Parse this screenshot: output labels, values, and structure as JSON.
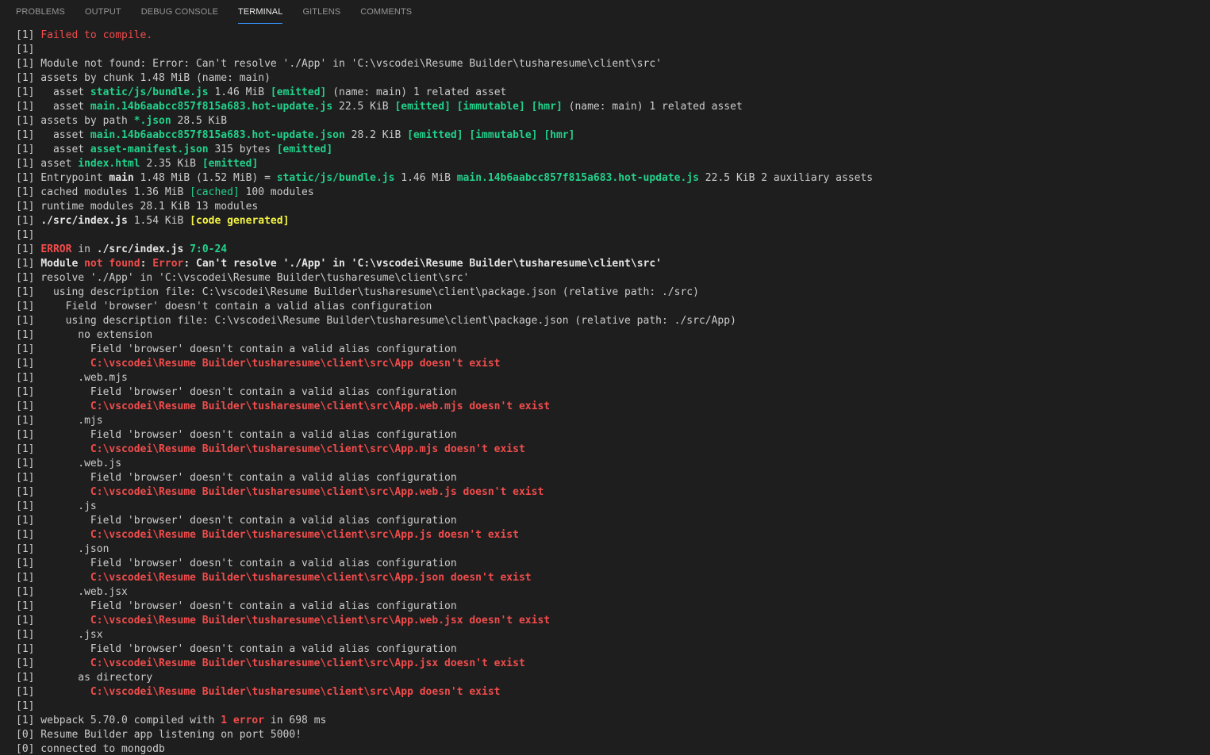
{
  "tabs": [
    "PROBLEMS",
    "OUTPUT",
    "DEBUG CONSOLE",
    "TERMINAL",
    "GITLENS",
    "COMMENTS"
  ],
  "active_tab": "TERMINAL",
  "colors": {
    "background": "#1e1e1e",
    "default": "#cccccc",
    "red": "#f14c4c",
    "green": "#23d18b",
    "yellow": "#f5f543",
    "active_tab_underline": "#3794ff"
  },
  "terminal_lines": [
    [
      {
        "t": "[1] "
      },
      {
        "t": "Failed to compile.",
        "c": "red"
      }
    ],
    [
      {
        "t": "[1]"
      }
    ],
    [
      {
        "t": "[1] Module not found: Error: Can't resolve './App' in 'C:\\vscodei\\Resume Builder\\tusharesume\\client\\src'"
      }
    ],
    [
      {
        "t": "[1] assets by chunk 1.48 MiB (name: main)"
      }
    ],
    [
      {
        "t": "[1]   asset "
      },
      {
        "t": "static/js/bundle.js",
        "c": "green b"
      },
      {
        "t": " 1.46 MiB "
      },
      {
        "t": "[emitted]",
        "c": "green b"
      },
      {
        "t": " (name: main) 1 related asset"
      }
    ],
    [
      {
        "t": "[1]   asset "
      },
      {
        "t": "main.14b6aabcc857f815a683.hot-update.js",
        "c": "green b"
      },
      {
        "t": " 22.5 KiB "
      },
      {
        "t": "[emitted]",
        "c": "green b"
      },
      {
        "t": " "
      },
      {
        "t": "[immutable]",
        "c": "green b"
      },
      {
        "t": " "
      },
      {
        "t": "[hmr]",
        "c": "green b"
      },
      {
        "t": " (name: main) 1 related asset"
      }
    ],
    [
      {
        "t": "[1] assets by path "
      },
      {
        "t": "*.json",
        "c": "green b"
      },
      {
        "t": " 28.5 KiB"
      }
    ],
    [
      {
        "t": "[1]   asset "
      },
      {
        "t": "main.14b6aabcc857f815a683.hot-update.json",
        "c": "green b"
      },
      {
        "t": " 28.2 KiB "
      },
      {
        "t": "[emitted]",
        "c": "green b"
      },
      {
        "t": " "
      },
      {
        "t": "[immutable]",
        "c": "green b"
      },
      {
        "t": " "
      },
      {
        "t": "[hmr]",
        "c": "green b"
      }
    ],
    [
      {
        "t": "[1]   asset "
      },
      {
        "t": "asset-manifest.json",
        "c": "green b"
      },
      {
        "t": " 315 bytes "
      },
      {
        "t": "[emitted]",
        "c": "green b"
      }
    ],
    [
      {
        "t": "[1] asset "
      },
      {
        "t": "index.html",
        "c": "green b"
      },
      {
        "t": " 2.35 KiB "
      },
      {
        "t": "[emitted]",
        "c": "green b"
      }
    ],
    [
      {
        "t": "[1] Entrypoint "
      },
      {
        "t": "main",
        "c": "b white"
      },
      {
        "t": " 1.48 MiB (1.52 MiB) = "
      },
      {
        "t": "static/js/bundle.js",
        "c": "green b"
      },
      {
        "t": " 1.46 MiB "
      },
      {
        "t": "main.14b6aabcc857f815a683.hot-update.js",
        "c": "green b"
      },
      {
        "t": " 22.5 KiB 2 auxiliary assets"
      }
    ],
    [
      {
        "t": "[1] cached modules 1.36 MiB "
      },
      {
        "t": "[cached]",
        "c": "green"
      },
      {
        "t": " 100 modules"
      }
    ],
    [
      {
        "t": "[1] runtime modules 28.1 KiB 13 modules"
      }
    ],
    [
      {
        "t": "[1] "
      },
      {
        "t": "./src/index.js",
        "c": "b white"
      },
      {
        "t": " 1.54 KiB "
      },
      {
        "t": "[code generated]",
        "c": "yellow b"
      }
    ],
    [
      {
        "t": "[1]"
      }
    ],
    [
      {
        "t": "[1] "
      },
      {
        "t": "ERROR",
        "c": "red b"
      },
      {
        "t": " in "
      },
      {
        "t": "./src/index.js",
        "c": "b white"
      },
      {
        "t": " "
      },
      {
        "t": "7:0-24",
        "c": "green b"
      }
    ],
    [
      {
        "t": "[1] "
      },
      {
        "t": "Module ",
        "c": "b white"
      },
      {
        "t": "not found",
        "c": "red b"
      },
      {
        "t": ": ",
        "c": "b white"
      },
      {
        "t": "Error",
        "c": "red b"
      },
      {
        "t": ": Can't resolve './App' in 'C:\\vscodei\\Resume Builder\\tusharesume\\client\\src'",
        "c": "b white"
      }
    ],
    [
      {
        "t": "[1] resolve './App' in 'C:\\vscodei\\Resume Builder\\tusharesume\\client\\src'"
      }
    ],
    [
      {
        "t": "[1]   using description file: C:\\vscodei\\Resume Builder\\tusharesume\\client\\package.json (relative path: ./src)"
      }
    ],
    [
      {
        "t": "[1]     Field 'browser' doesn't contain a valid alias configuration"
      }
    ],
    [
      {
        "t": "[1]     using description file: C:\\vscodei\\Resume Builder\\tusharesume\\client\\package.json (relative path: ./src/App)"
      }
    ],
    [
      {
        "t": "[1]       no extension"
      }
    ],
    [
      {
        "t": "[1]         Field 'browser' doesn't contain a valid alias configuration"
      }
    ],
    [
      {
        "t": "[1]         "
      },
      {
        "t": "C:\\vscodei\\Resume Builder\\tusharesume\\client\\src\\App doesn't exist",
        "c": "red b"
      }
    ],
    [
      {
        "t": "[1]       .web.mjs"
      }
    ],
    [
      {
        "t": "[1]         Field 'browser' doesn't contain a valid alias configuration"
      }
    ],
    [
      {
        "t": "[1]         "
      },
      {
        "t": "C:\\vscodei\\Resume Builder\\tusharesume\\client\\src\\App.web.mjs doesn't exist",
        "c": "red b"
      }
    ],
    [
      {
        "t": "[1]       .mjs"
      }
    ],
    [
      {
        "t": "[1]         Field 'browser' doesn't contain a valid alias configuration"
      }
    ],
    [
      {
        "t": "[1]         "
      },
      {
        "t": "C:\\vscodei\\Resume Builder\\tusharesume\\client\\src\\App.mjs doesn't exist",
        "c": "red b"
      }
    ],
    [
      {
        "t": "[1]       .web.js"
      }
    ],
    [
      {
        "t": "[1]         Field 'browser' doesn't contain a valid alias configuration"
      }
    ],
    [
      {
        "t": "[1]         "
      },
      {
        "t": "C:\\vscodei\\Resume Builder\\tusharesume\\client\\src\\App.web.js doesn't exist",
        "c": "red b"
      }
    ],
    [
      {
        "t": "[1]       .js"
      }
    ],
    [
      {
        "t": "[1]         Field 'browser' doesn't contain a valid alias configuration"
      }
    ],
    [
      {
        "t": "[1]         "
      },
      {
        "t": "C:\\vscodei\\Resume Builder\\tusharesume\\client\\src\\App.js doesn't exist",
        "c": "red b"
      }
    ],
    [
      {
        "t": "[1]       .json"
      }
    ],
    [
      {
        "t": "[1]         Field 'browser' doesn't contain a valid alias configuration"
      }
    ],
    [
      {
        "t": "[1]         "
      },
      {
        "t": "C:\\vscodei\\Resume Builder\\tusharesume\\client\\src\\App.json doesn't exist",
        "c": "red b"
      }
    ],
    [
      {
        "t": "[1]       .web.jsx"
      }
    ],
    [
      {
        "t": "[1]         Field 'browser' doesn't contain a valid alias configuration"
      }
    ],
    [
      {
        "t": "[1]         "
      },
      {
        "t": "C:\\vscodei\\Resume Builder\\tusharesume\\client\\src\\App.web.jsx doesn't exist",
        "c": "red b"
      }
    ],
    [
      {
        "t": "[1]       .jsx"
      }
    ],
    [
      {
        "t": "[1]         Field 'browser' doesn't contain a valid alias configuration"
      }
    ],
    [
      {
        "t": "[1]         "
      },
      {
        "t": "C:\\vscodei\\Resume Builder\\tusharesume\\client\\src\\App.jsx doesn't exist",
        "c": "red b"
      }
    ],
    [
      {
        "t": "[1]       as directory"
      }
    ],
    [
      {
        "t": "[1]         "
      },
      {
        "t": "C:\\vscodei\\Resume Builder\\tusharesume\\client\\src\\App doesn't exist",
        "c": "red b"
      }
    ],
    [
      {
        "t": "[1]"
      }
    ],
    [
      {
        "t": "[1] webpack 5.70.0 compiled with "
      },
      {
        "t": "1 error",
        "c": "red b"
      },
      {
        "t": " in 698 ms"
      }
    ],
    [
      {
        "t": "[0] Resume Builder app listening on port 5000!"
      }
    ],
    [
      {
        "t": "[0] connected to mongodb"
      }
    ]
  ]
}
